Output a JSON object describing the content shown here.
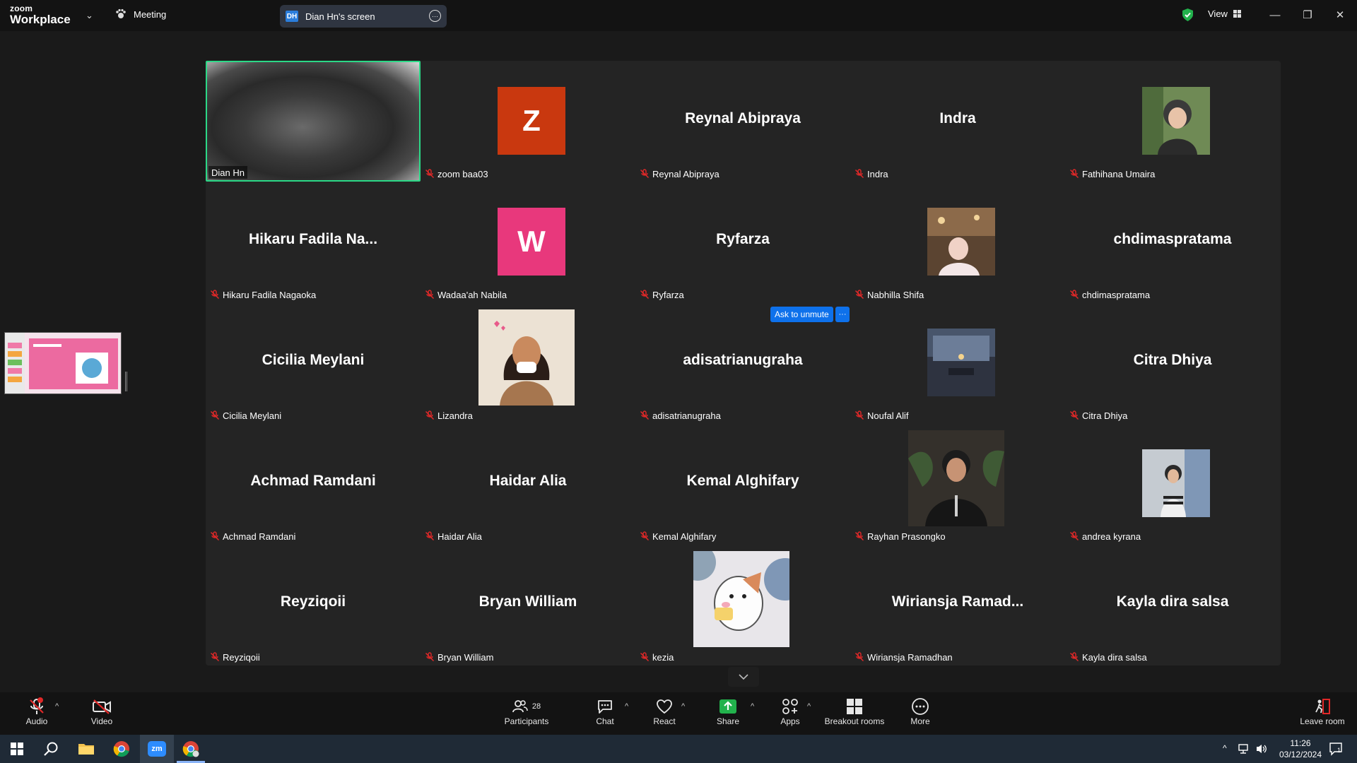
{
  "titlebar": {
    "brand_top": "zoom",
    "brand_bottom": "Workplace",
    "meeting_label": "Meeting",
    "screen_tab_badge": "DH",
    "screen_tab_label": "Dian Hn's screen",
    "view_label": "View"
  },
  "ask_to_unmute": "Ask to unmute",
  "ask_more": "···",
  "participants": [
    {
      "label": "Dian Hn",
      "display": "video"
    },
    {
      "label": "zoom baa03",
      "display": "initial",
      "initial": "Z",
      "color": "#c9380f"
    },
    {
      "label": "Reynal Abipraya",
      "display": "name",
      "center": "Reynal Abipraya"
    },
    {
      "label": "Indra",
      "display": "name",
      "center": "Indra"
    },
    {
      "label": "Fathihana Umaira",
      "display": "photo"
    },
    {
      "label": "Hikaru Fadila Nagaoka",
      "display": "name",
      "center": "Hikaru  Fadila  Na..."
    },
    {
      "label": "Wadaa'ah Nabila",
      "display": "initial",
      "initial": "W",
      "color": "#e8387c"
    },
    {
      "label": "Ryfarza",
      "display": "name",
      "center": "Ryfarza"
    },
    {
      "label": "Nabhilla Shifa",
      "display": "photo"
    },
    {
      "label": "chdimaspratama",
      "display": "name",
      "center": "chdimaspratama"
    },
    {
      "label": "Cicilia Meylani",
      "display": "name",
      "center": "Cicilia Meylani"
    },
    {
      "label": "Lizandra",
      "display": "photo-big"
    },
    {
      "label": "adisatrianugraha",
      "display": "name",
      "center": "adisatrianugraha"
    },
    {
      "label": "Noufal Alif",
      "display": "photo"
    },
    {
      "label": "Citra Dhiya",
      "display": "name",
      "center": "Citra Dhiya"
    },
    {
      "label": "Achmad Ramdani",
      "display": "name",
      "center": "Achmad Ramdani"
    },
    {
      "label": "Haidar Alia",
      "display": "name",
      "center": "Haidar Alia"
    },
    {
      "label": "Kemal Alghifary",
      "display": "name",
      "center": "Kemal Alghifary"
    },
    {
      "label": "Rayhan Prasongko",
      "display": "photo-big"
    },
    {
      "label": "andrea kyrana",
      "display": "photo"
    },
    {
      "label": "Reyziqoii",
      "display": "name",
      "center": "Reyziqoii"
    },
    {
      "label": "Bryan William",
      "display": "name",
      "center": "Bryan William"
    },
    {
      "label": "kezia",
      "display": "photo-big"
    },
    {
      "label": "Wiriansja Ramadhan",
      "display": "name",
      "center": "Wiriansja  Ramad..."
    },
    {
      "label": "Kayla dira salsa",
      "display": "name",
      "center": "Kayla dira salsa"
    }
  ],
  "toolbar": {
    "audio": "Audio",
    "video": "Video",
    "participants": "Participants",
    "participants_count": "28",
    "chat": "Chat",
    "react": "React",
    "share": "Share",
    "apps": "Apps",
    "breakout": "Breakout rooms",
    "more": "More",
    "leave": "Leave room"
  },
  "taskbar": {
    "time": "11:26",
    "date": "03/12/2024",
    "notifications": "1"
  },
  "colors": {
    "accent_green": "#2bd987",
    "zoom_blue": "#0e71eb",
    "muted_red": "#e02828"
  }
}
